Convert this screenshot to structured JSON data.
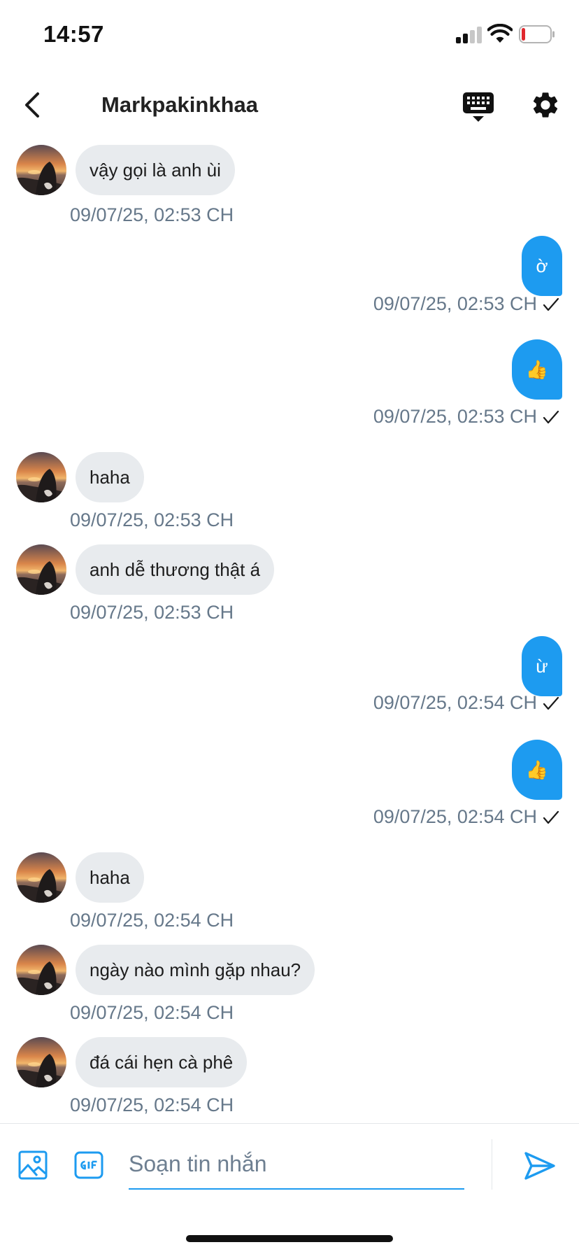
{
  "status_bar": {
    "time": "14:57"
  },
  "header": {
    "title": "Markpakinkhaa"
  },
  "messages": [
    {
      "direction": "in",
      "text": "vậy gọi là anh ùi",
      "time": "09/07/25, 02:53 CH"
    },
    {
      "direction": "out",
      "text": "ờ",
      "time": "09/07/25, 02:53 CH"
    },
    {
      "direction": "out",
      "text": "👍",
      "time": "09/07/25, 02:53 CH"
    },
    {
      "direction": "in",
      "text": "haha",
      "time": "09/07/25, 02:53 CH"
    },
    {
      "direction": "in",
      "text": "anh dễ thương thật á",
      "time": "09/07/25, 02:53 CH"
    },
    {
      "direction": "out",
      "text": "ừ",
      "time": "09/07/25, 02:54 CH"
    },
    {
      "direction": "out",
      "text": "👍",
      "time": "09/07/25, 02:54 CH"
    },
    {
      "direction": "in",
      "text": "haha",
      "time": "09/07/25, 02:54 CH"
    },
    {
      "direction": "in",
      "text": "ngày nào mình gặp nhau?",
      "time": "09/07/25, 02:54 CH"
    },
    {
      "direction": "in",
      "text": "đá cái hẹn cà phê",
      "time": "09/07/25, 02:54 CH"
    }
  ],
  "composer": {
    "placeholder": "Soạn tin nhắn",
    "value": ""
  },
  "icons": {
    "back": "chevron-left-icon",
    "keyboard": "keyboard-icon",
    "settings": "gear-icon",
    "image": "image-icon",
    "gif": "gif-icon",
    "send": "send-icon",
    "read_receipt": "checkmark-icon"
  },
  "colors": {
    "accent": "#1d9bf0",
    "incoming_bubble": "#e8ebee",
    "timestamp": "#66788a",
    "battery_low": "#e0282e"
  }
}
